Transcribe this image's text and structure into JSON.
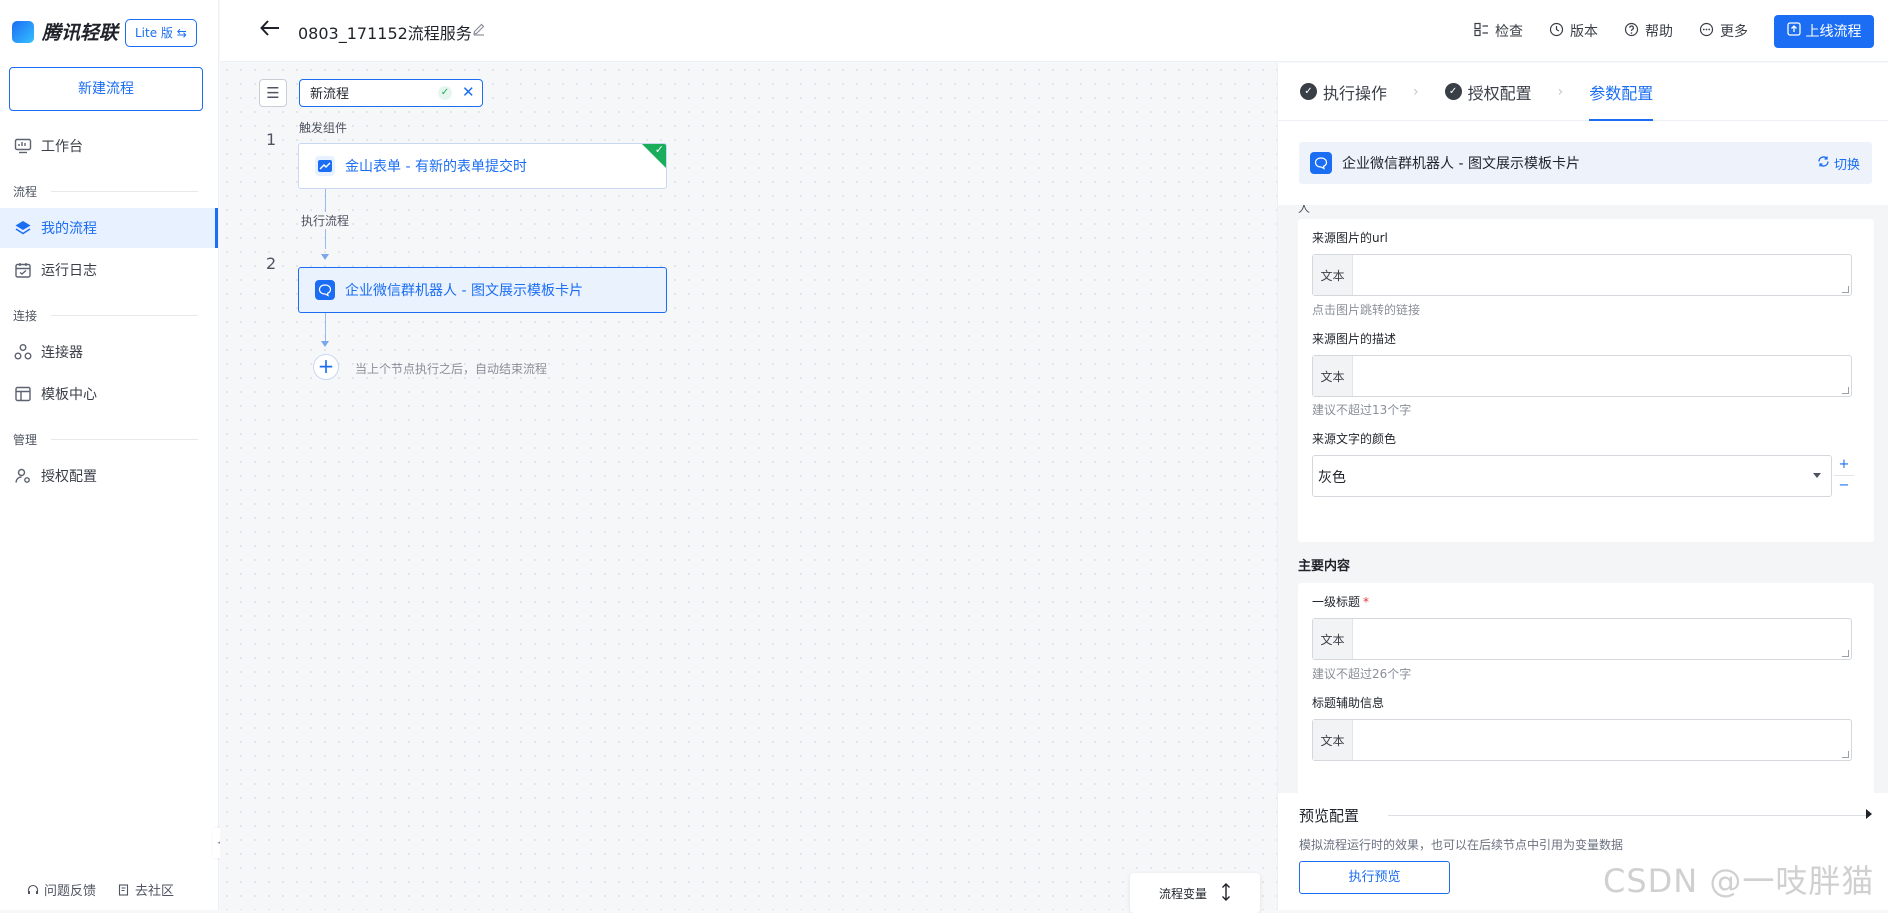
{
  "brand": {
    "name": "腾讯轻联",
    "edition": "Lite 版 ⇆"
  },
  "sidebar": {
    "new_flow_button": "新建流程",
    "items": [
      {
        "label": "工作台",
        "icon": "dashboard-icon"
      },
      {
        "section": "流程"
      },
      {
        "label": "我的流程",
        "icon": "layers-icon",
        "active": true
      },
      {
        "label": "运行日志",
        "icon": "calendar-icon"
      },
      {
        "section": "连接"
      },
      {
        "label": "连接器",
        "icon": "connector-icon"
      },
      {
        "label": "模板中心",
        "icon": "template-icon"
      },
      {
        "section": "管理"
      },
      {
        "label": "授权配置",
        "icon": "user-key-icon"
      }
    ],
    "footer": {
      "feedback": "问题反馈",
      "community": "去社区"
    }
  },
  "topbar": {
    "title": "0803_171152流程服务",
    "actions": {
      "check": "检查",
      "version": "版本",
      "help": "帮助",
      "more": "更多"
    },
    "publish": "上线流程"
  },
  "canvas": {
    "flow_name_value": "新流程",
    "trigger_label": "触发组件",
    "exec_label": "执行流程",
    "nodes": [
      {
        "index": "1",
        "text": "金山表单 - 有新的表单提交时",
        "icon": "kingsoft-form-icon",
        "done": true
      },
      {
        "index": "2",
        "text": "企业微信群机器人 - 图文展示模板卡片",
        "icon": "wecom-bot-icon",
        "selected": true
      }
    ],
    "end_hint": "当上个节点执行之后，自动结束流程",
    "variables": "流程变量"
  },
  "panel": {
    "steps": [
      {
        "label": "执行操作",
        "done": true
      },
      {
        "label": "授权配置",
        "done": true
      },
      {
        "label": "参数配置",
        "active": true
      }
    ],
    "component": {
      "text": "企业微信群机器人 - 图文展示模板卡片",
      "switch": "切换"
    },
    "cut_label": "人",
    "fields_a": {
      "source_image_url": {
        "label": "来源图片的url",
        "tag": "文本",
        "hint": "点击图片跳转的链接"
      },
      "source_image_desc": {
        "label": "来源图片的描述",
        "tag": "文本",
        "hint": "建议不超过13个字"
      },
      "source_text_color": {
        "label": "来源文字的颜色",
        "value": "灰色"
      }
    },
    "main_section": "主要内容",
    "fields_b": {
      "main_title": {
        "label": "一级标题",
        "required": "*",
        "tag": "文本",
        "hint": "建议不超过26个字"
      },
      "title_aux": {
        "label": "标题辅助信息",
        "tag": "文本"
      }
    },
    "preview": {
      "title": "预览配置",
      "desc": "模拟流程运行时的效果，也可以在后续节点中引用为变量数据",
      "button": "执行预览"
    }
  },
  "watermark": "CSDN @一吱胖猫",
  "colors": {
    "primary": "#1b6ef3",
    "success": "#1aad5b",
    "required": "#e5383b"
  }
}
